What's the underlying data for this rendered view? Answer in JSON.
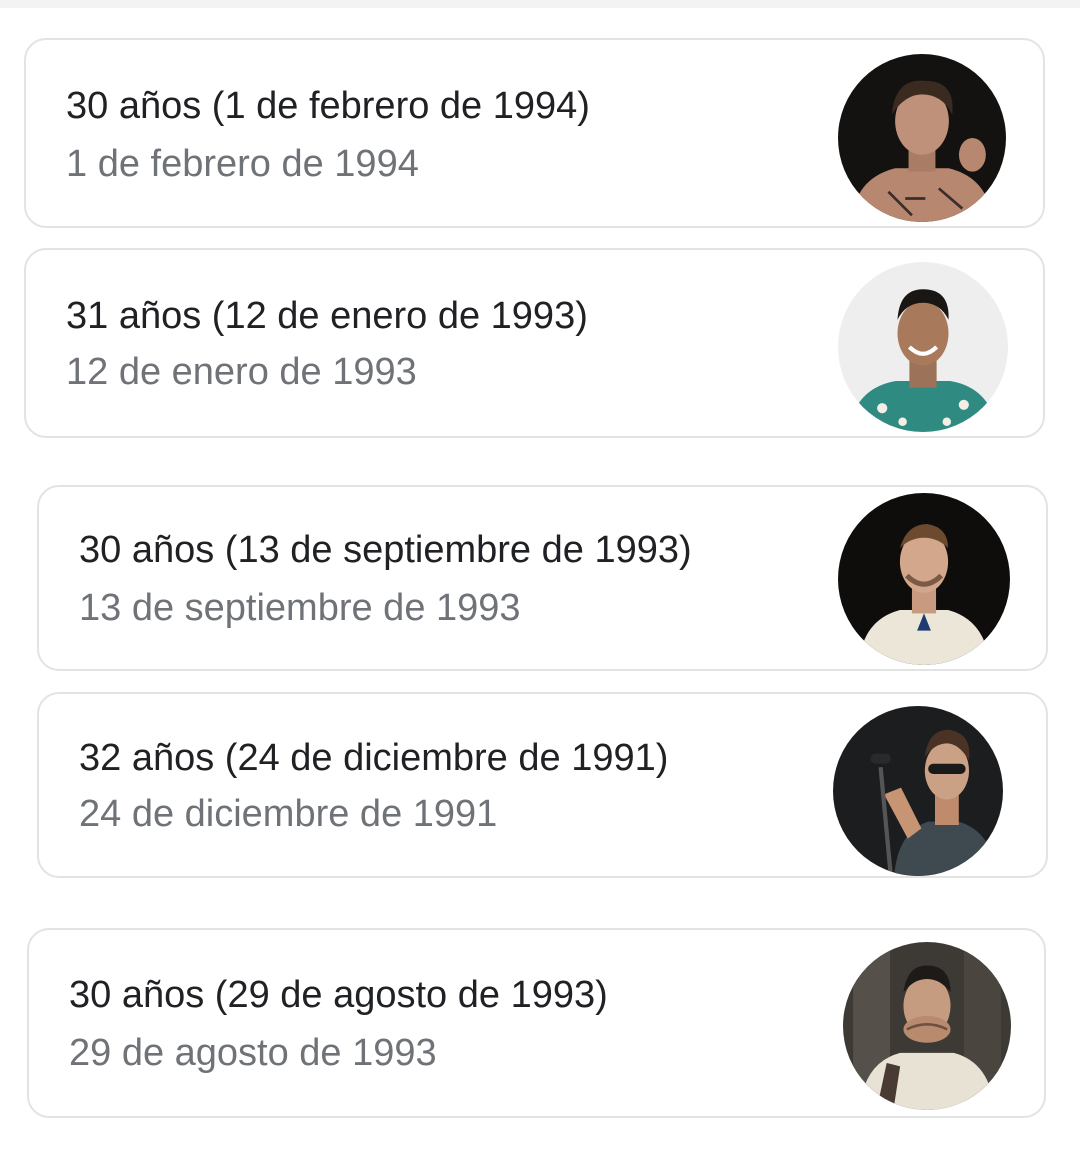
{
  "cards": [
    {
      "age": "30 años (1 de febrero de 1994)",
      "date": "1 de febrero de 1994",
      "avatar": "portrait-photo-dark-background"
    },
    {
      "age": "31 años (12 de enero de 1993)",
      "date": "12 de enero de 1993",
      "avatar": "portrait-photo-light-background"
    },
    {
      "age": "30 años (13 de septiembre de 1993)",
      "date": "13 de septiembre de 1993",
      "avatar": "portrait-photo-dark-background"
    },
    {
      "age": "32 años (24 de diciembre de 1991)",
      "date": "24 de diciembre de 1991",
      "avatar": "portrait-photo-stage-microphone"
    },
    {
      "age": "30 años (29 de agosto de 1993)",
      "date": "29 de agosto de 1993",
      "avatar": "portrait-photo-indoor"
    }
  ]
}
